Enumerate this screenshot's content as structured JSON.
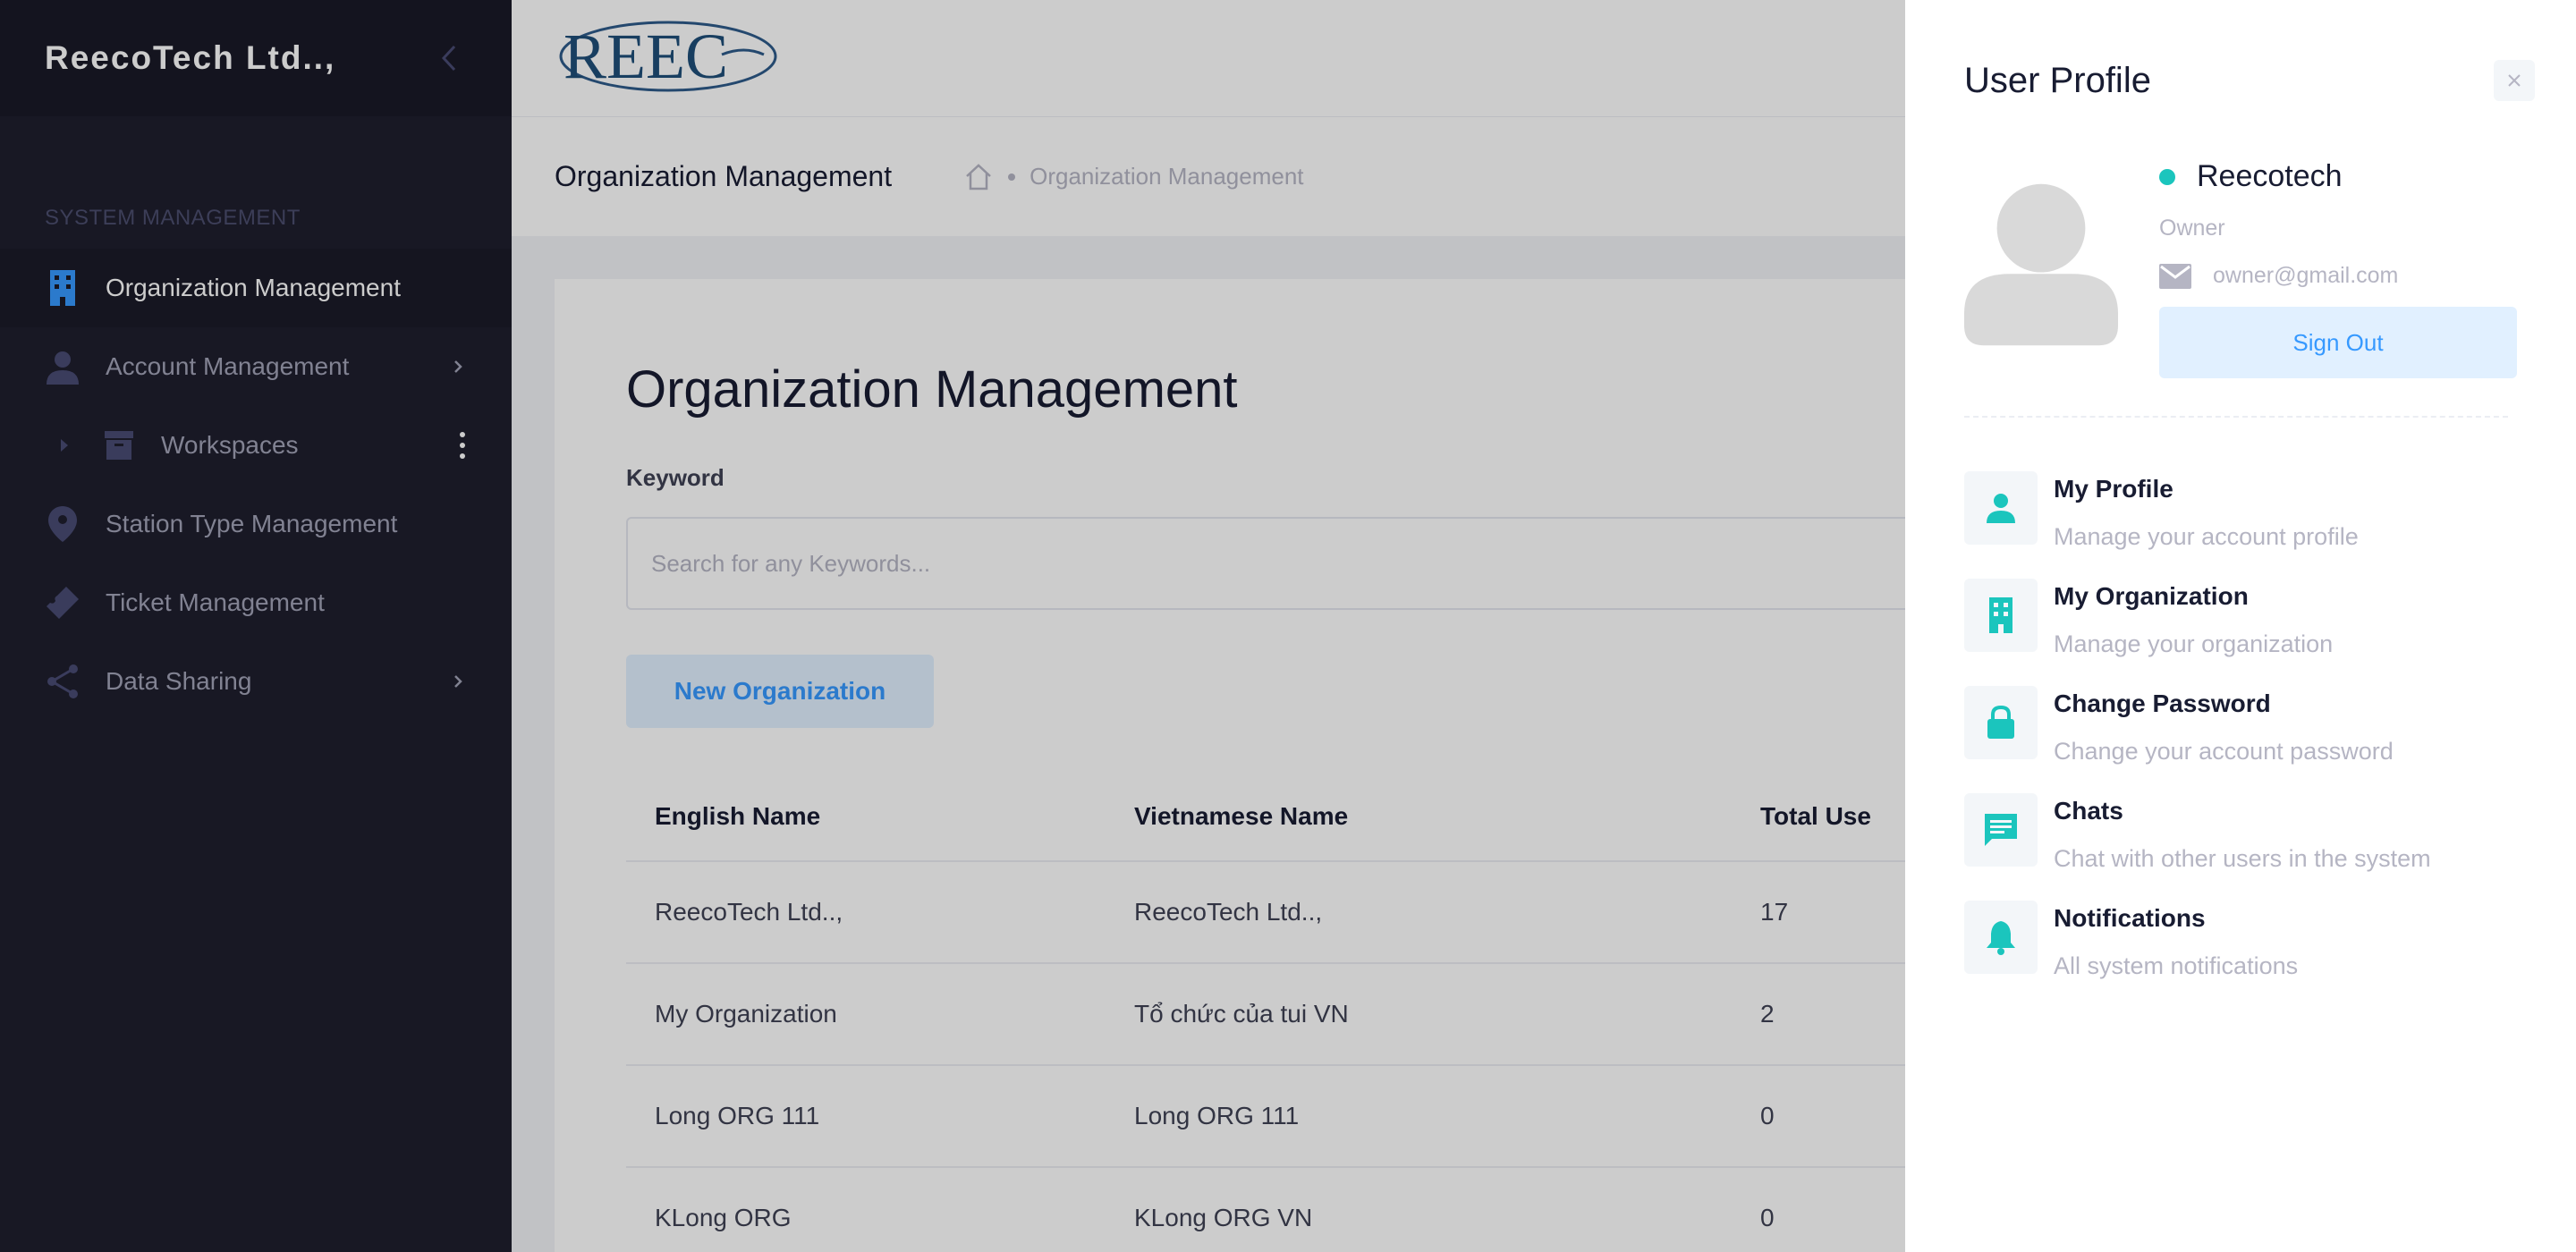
{
  "sidebar": {
    "brand": "ReecoTech Ltd..,",
    "section_title": "SYSTEM MANAGEMENT",
    "items": [
      {
        "label": "Organization Management",
        "icon": "building-icon"
      },
      {
        "label": "Account Management",
        "icon": "user-icon"
      },
      {
        "label": "Workspaces",
        "icon": "archive-icon"
      },
      {
        "label": "Station Type Management",
        "icon": "map-pin-icon"
      },
      {
        "label": "Ticket Management",
        "icon": "ticket-icon"
      },
      {
        "label": "Data Sharing",
        "icon": "share-icon"
      }
    ]
  },
  "header": {
    "logo_text": "REEC"
  },
  "subheader": {
    "title": "Organization Management",
    "breadcrumb": "Organization Management"
  },
  "main": {
    "page_title": "Organization Management",
    "keyword_label": "Keyword",
    "search_placeholder": "Search for any Keywords...",
    "new_button": "New Organization",
    "table": {
      "headers": [
        "English Name",
        "Vietnamese Name",
        "Total Use"
      ],
      "rows": [
        [
          "ReecoTech Ltd..,",
          "ReecoTech Ltd..,",
          "17"
        ],
        [
          "My Organization",
          "Tổ chức của tui VN",
          "2"
        ],
        [
          "Long ORG 111",
          "Long ORG 111",
          "0"
        ],
        [
          "KLong ORG",
          "KLong ORG VN",
          "0"
        ]
      ]
    }
  },
  "profile_panel": {
    "title": "User Profile",
    "user_name": "Reecotech",
    "role": "Owner",
    "email": "owner@gmail.com",
    "sign_out": "Sign Out",
    "nav": [
      {
        "title": "My Profile",
        "desc": "Manage your account profile",
        "icon": "user-icon"
      },
      {
        "title": "My Organization",
        "desc": "Manage your organization",
        "icon": "building-icon"
      },
      {
        "title": "Change Password",
        "desc": "Change your account password",
        "icon": "lock-icon"
      },
      {
        "title": "Chats",
        "desc": "Chat with other users in the system",
        "icon": "chat-icon"
      },
      {
        "title": "Notifications",
        "desc": "All system notifications",
        "icon": "bell-icon"
      }
    ]
  },
  "colors": {
    "sidebar_bg": "#1e1e2d",
    "accent_blue": "#3699ff",
    "accent_teal": "#1bc5bd",
    "light_blue_bg": "#e1f0ff"
  }
}
